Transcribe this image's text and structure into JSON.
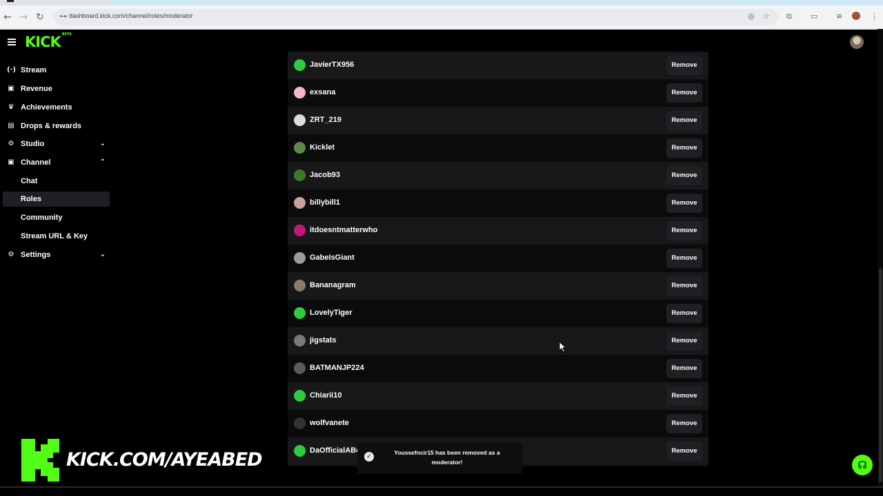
{
  "browser": {
    "url": "dashboard.kick.com/channel/roles/moderator"
  },
  "app": {
    "logo": "KICK",
    "logo_badge": "BETA"
  },
  "sidebar": {
    "items": [
      {
        "label": "Stream",
        "icon": "broadcast-icon",
        "glyph": "(·)"
      },
      {
        "label": "Revenue",
        "icon": "wallet-icon",
        "glyph": "▣"
      },
      {
        "label": "Achievements",
        "icon": "trophy-icon",
        "glyph": "🏆"
      },
      {
        "label": "Drops & rewards",
        "icon": "gift-icon",
        "glyph": "▤"
      },
      {
        "label": "Studio",
        "icon": "gear-icon",
        "glyph": "⚙",
        "chevron": "down"
      },
      {
        "label": "Channel",
        "icon": "channel-icon",
        "glyph": "▣",
        "chevron": "up"
      },
      {
        "label": "Chat",
        "sub": true
      },
      {
        "label": "Roles",
        "sub": true,
        "active": true
      },
      {
        "label": "Community",
        "sub": true
      },
      {
        "label": "Stream URL & Key",
        "sub": true
      },
      {
        "label": "Settings",
        "icon": "settings-icon",
        "glyph": "⚙",
        "chevron": "down"
      }
    ]
  },
  "moderators": {
    "remove_label": "Remove",
    "rows": [
      {
        "name": "JavierTX956",
        "avatar_color": "#2ecc40"
      },
      {
        "name": "exsana",
        "avatar_color": "#f2b8c6"
      },
      {
        "name": "ZRT_219",
        "avatar_color": "#dddddd"
      },
      {
        "name": "Kicklet",
        "avatar_color": "#5a8a4a"
      },
      {
        "name": "Jacob93",
        "avatar_color": "#3a7a2a"
      },
      {
        "name": "billybill1",
        "avatar_color": "#c9a0a0"
      },
      {
        "name": "itdoesntmatterwho",
        "avatar_color": "#c2187a"
      },
      {
        "name": "GabeIsGiant",
        "avatar_color": "#9a9a9a"
      },
      {
        "name": "Bananagram",
        "avatar_color": "#8a7a6a"
      },
      {
        "name": "LovelyTiger",
        "avatar_color": "#2ecc40"
      },
      {
        "name": "jigstats",
        "avatar_color": "#7a7a7a"
      },
      {
        "name": "BATMANJP224",
        "avatar_color": "#5a5a5a"
      },
      {
        "name": "Chiarii10",
        "avatar_color": "#2ecc40"
      },
      {
        "name": "wolfvanete",
        "avatar_color": "#333333"
      },
      {
        "name": "DaOfficialABc",
        "avatar_color": "#2ecc40"
      }
    ]
  },
  "toast": {
    "message": "Youssefncir15 has been removed as a moderator!"
  },
  "watermark": {
    "text": "KICK.COM/AYEABED"
  },
  "colors": {
    "brand": "#53fc18",
    "background": "#000000",
    "row_alt": "#18181b"
  }
}
